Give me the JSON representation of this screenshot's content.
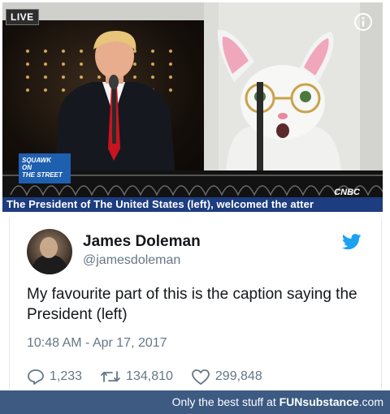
{
  "video": {
    "live_badge": "LIVE",
    "show_logo_line1": "SQUAWK",
    "show_logo_line2": "ON",
    "show_logo_line3": "THE STREET",
    "network_logo": "CNBC",
    "caption": "The President of The United States (left), welcomed the atter",
    "info_icon": "info-icon"
  },
  "tweet": {
    "author_name": "James Doleman",
    "author_handle": "@jamesdoleman",
    "text": "My favourite part of this is the caption saying the President (left)",
    "timestamp": "10:48 AM - Apr 17, 2017",
    "reply_count": "1,233",
    "retweet_count": "134,810",
    "like_count": "299,848",
    "accent_color": "#1da1f2"
  },
  "footer": {
    "prefix": "Only the best stuff at ",
    "brand_bold": "FUN",
    "brand_rest": "substance",
    "brand_tld": ".com"
  }
}
